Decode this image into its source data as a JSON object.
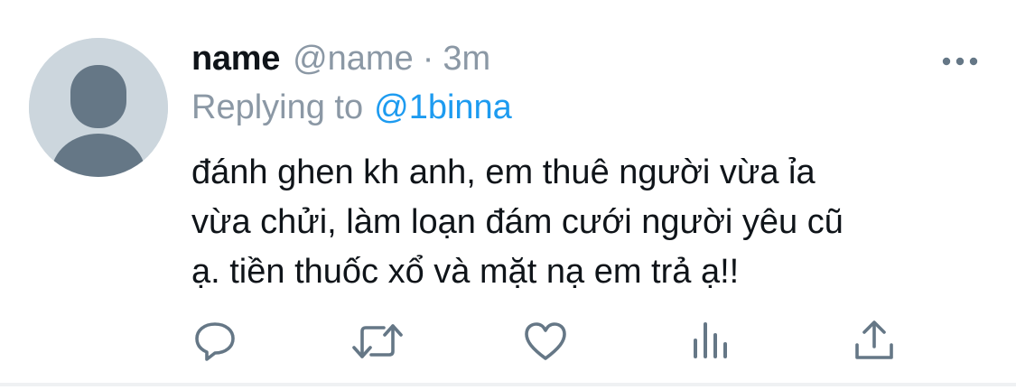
{
  "tweet": {
    "author_name": "name",
    "author_handle": "@name",
    "separator": "·",
    "timestamp": "3m",
    "replying_label": "Replying to",
    "replying_to": "@1binna",
    "text": "đánh ghen kh anh, em thuê người vừa ỉa\nvừa chửi, làm loạn đám cưới người yêu cũ\nạ. tiền thuốc xổ và mặt nạ em trả ạ!!"
  },
  "actions": [
    {
      "name": "reply",
      "icon": "speech-bubble-icon"
    },
    {
      "name": "retweet",
      "icon": "retweet-icon"
    },
    {
      "name": "like",
      "icon": "heart-icon"
    },
    {
      "name": "analytics",
      "icon": "bar-chart-icon"
    },
    {
      "name": "share",
      "icon": "share-icon"
    }
  ],
  "colors": {
    "text_primary": "#0f1419",
    "text_secondary": "#8b98a5",
    "link": "#1d9bf0",
    "avatar_bg": "#ccd6dd",
    "avatar_figure": "#657786",
    "icon": "#657786"
  }
}
